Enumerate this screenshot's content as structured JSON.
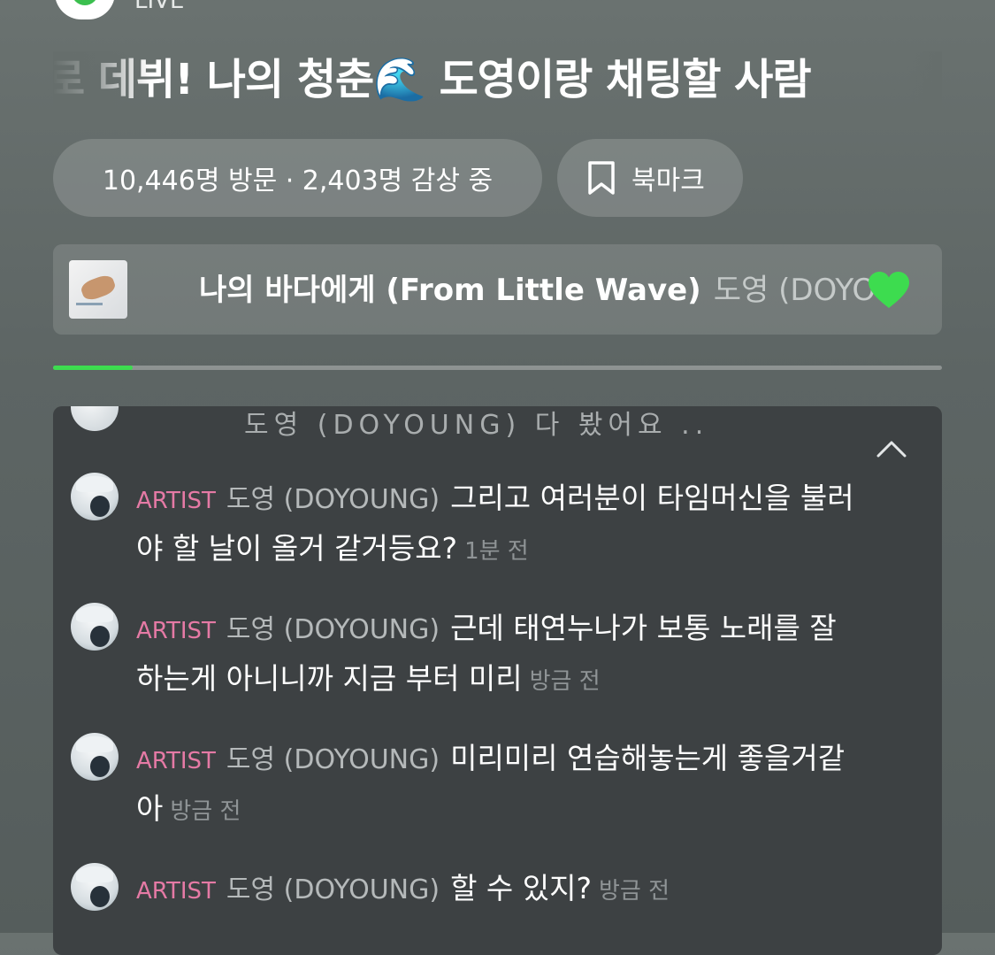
{
  "header": {
    "channel_name": "LIVE",
    "title": "로 데뷔! 나의 청춘🌊 도영이랑 채팅할 사람"
  },
  "stats": {
    "text": "10,446명 방문 · 2,403명 감상 중"
  },
  "bookmark": {
    "label": "북마크",
    "icon": "bookmark-icon"
  },
  "now_playing": {
    "song": "나의 바다에게 (From Little Wave)",
    "artist": "도영 (DOYOUNG)",
    "liked": true,
    "progress": 0.09,
    "accent": "#3ddc4f"
  },
  "chat": {
    "ghost_text": "도영 (DOYOUNG) 다 봤어요 ..",
    "messages": [
      {
        "role": "ARTIST",
        "name": "도영 (DOYOUNG)",
        "text": "그리고 여러분이 타임머신을 불러야 할 날이 올거 같거등요?",
        "time": "1분 전"
      },
      {
        "role": "ARTIST",
        "name": "도영 (DOYOUNG)",
        "text": "근데 태연누나가 보통 노래를 잘하는게 아니니까 지금 부터 미리",
        "time": "방금 전"
      },
      {
        "role": "ARTIST",
        "name": "도영 (DOYOUNG)",
        "text": "미리미리 연습해놓는게 좋을거같아",
        "time": "방금 전"
      },
      {
        "role": "ARTIST",
        "name": "도영 (DOYOUNG)",
        "text": "할 수 있지?",
        "time": "방금 전"
      }
    ]
  }
}
